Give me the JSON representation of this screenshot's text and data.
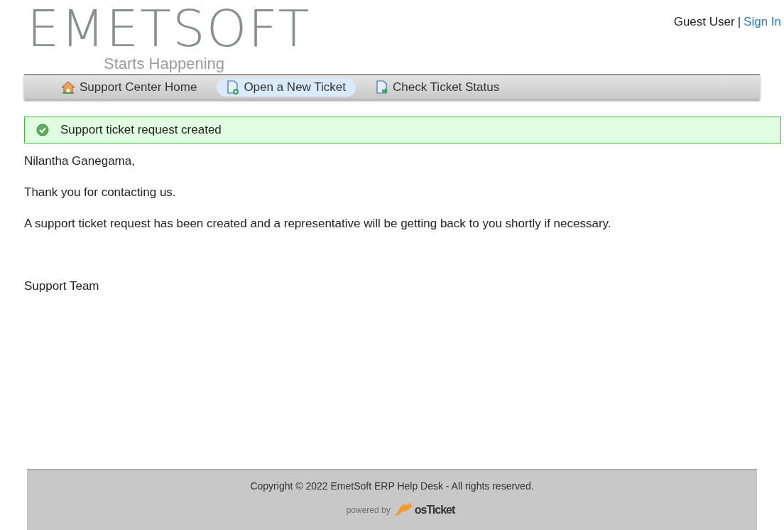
{
  "header": {
    "logo": "EMETSOFT",
    "tagline": "Starts Happening",
    "user": "Guest User",
    "separator": "|",
    "sign_in": "Sign In"
  },
  "nav": [
    {
      "label": "Support Center Home",
      "kind": "home",
      "selected": false
    },
    {
      "label": "Open a New Ticket",
      "kind": "new",
      "selected": true
    },
    {
      "label": "Check Ticket Status",
      "kind": "status",
      "selected": false
    }
  ],
  "notice": "Support ticket request created",
  "message": [
    "Nilantha Ganegama,",
    "Thank you for contacting us.",
    "A support ticket request has been created and a representative will be getting back to you shortly if necessary."
  ],
  "signature": "Support Team",
  "footer": {
    "copyright": "Copyright © 2022 EmetSoft ERP Help Desk - All rights reserved.",
    "powered_by": "powered by",
    "brand": "osTicket"
  }
}
